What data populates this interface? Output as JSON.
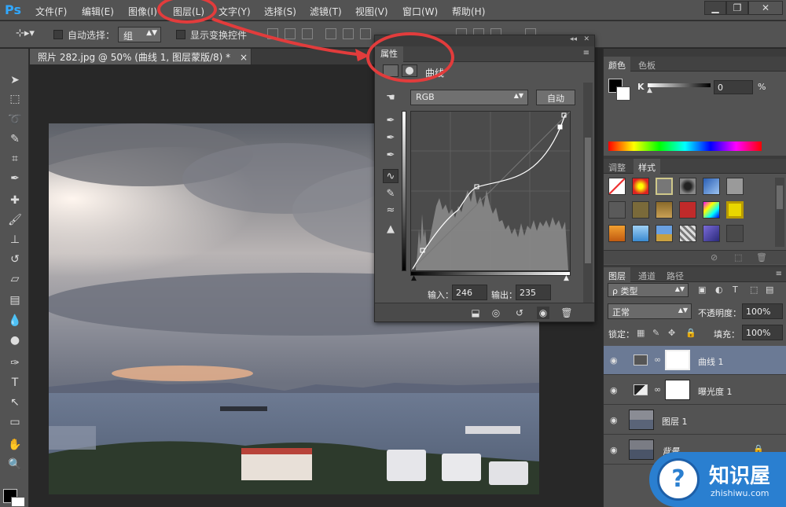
{
  "app": {
    "logo": "Ps"
  },
  "menu": [
    "文件(F)",
    "编辑(E)",
    "图像(I)",
    "图层(L)",
    "文字(Y)",
    "选择(S)",
    "滤镜(T)",
    "视图(V)",
    "窗口(W)",
    "帮助(H)"
  ],
  "window_controls": {
    "minimize": "▁",
    "restore": "❐",
    "close": "✕"
  },
  "options": {
    "auto_select_label": "自动选择：",
    "auto_select_value": "组",
    "show_transform_label": "显示变换控件"
  },
  "document": {
    "tab_title": "照片 282.jpg @ 50% (曲线 1, 图层蒙版/8) *",
    "tab_close": "×"
  },
  "properties": {
    "tab_label": "属性",
    "title": "曲线",
    "channel": "RGB",
    "auto_button": "自动",
    "input_label": "输入：",
    "input_value": "246",
    "output_label": "输出：",
    "output_value": "235"
  },
  "color_panel": {
    "tabs": [
      "颜色",
      "色板"
    ],
    "k_label": "K",
    "k_value": "0",
    "percent": "%",
    "colors": {
      "foreground": "#000000",
      "background": "#ffffff"
    }
  },
  "styles_panel": {
    "tabs": [
      "调整",
      "样式"
    ]
  },
  "layers_panel": {
    "tabs": [
      "图层",
      "通道",
      "路径"
    ],
    "filter_type": "ρ 类型",
    "blend_mode": "正常",
    "opacity_label": "不透明度：",
    "opacity_value": "100%",
    "lock_label": "锁定：",
    "fill_label": "填充：",
    "fill_value": "100%",
    "layers": [
      {
        "name": "曲线 1",
        "selected": true
      },
      {
        "name": "曝光度 1",
        "selected": false
      },
      {
        "name": "图层 1",
        "selected": false
      },
      {
        "name": "背景",
        "selected": false
      }
    ]
  },
  "watermark": {
    "brand": "知识屋",
    "url": "zhishiwu.com"
  },
  "accent_color": "#e23c3c"
}
